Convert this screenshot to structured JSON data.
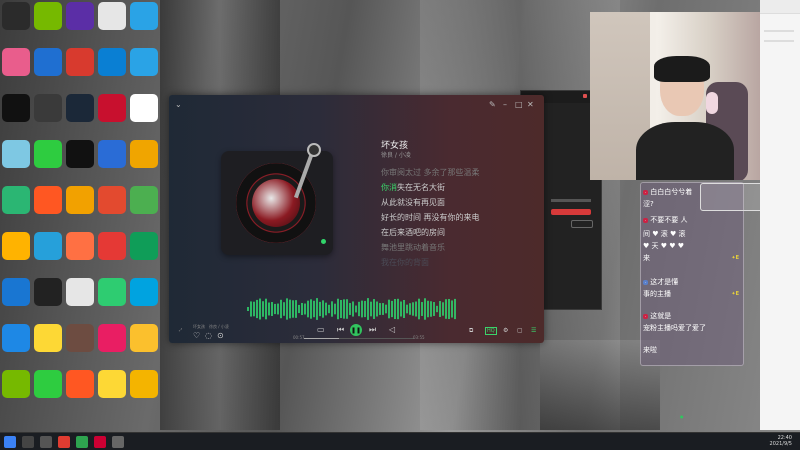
{
  "player": {
    "song_title": "坏女孩",
    "song_artist": "徐良 / 小凌",
    "lyrics": [
      "你审阅太过 多余了那些温柔",
      "你消失在无名大街",
      "从此就没有再见面",
      "好长的时间 再没有你的来电",
      "在后来酒吧的房间",
      "舞池里跳动着音乐",
      "我在你的背面"
    ],
    "highlight_prefix": "你消",
    "highlight_rest": "失在无名大街",
    "current_time": "00:57",
    "total_time": "03:55",
    "progress": 0.32,
    "now_playing_short": "坏女孩",
    "now_playing_sub": "徐良 / 小凌",
    "quality_label": "HQ"
  },
  "chat": {
    "messages": [
      {
        "badge": "",
        "text": "白白白兮兮",
        "tail": "着",
        "extra": ""
      },
      {
        "badge": "",
        "text": "涩?",
        "tail": "",
        "extra": ""
      },
      {
        "badge": "",
        "text": "不要不要  人",
        "tail": "",
        "extra": ""
      },
      {
        "badge": "",
        "text": "间 ♥ 滚 ♥ 滚",
        "tail": "",
        "extra": ""
      },
      {
        "badge": "",
        "text": "♥ 天 ♥ ♥ ♥",
        "tail": "",
        "extra": ""
      },
      {
        "badge": "",
        "text": "来",
        "tail": "",
        "extra": ""
      },
      {
        "badge": "",
        "text": "这才是懂",
        "tail": "",
        "extra": ""
      },
      {
        "badge": "",
        "text": "事的主播",
        "tail": "",
        "extra": ""
      },
      {
        "badge": "",
        "text": "这就是",
        "tail": "",
        "extra": ""
      },
      {
        "badge": "",
        "text": "宠粉主播吗爱了爱了",
        "tail": "",
        "extra": ""
      },
      {
        "badge": "",
        "text": "来啦",
        "tail": "",
        "extra": ""
      }
    ]
  },
  "taskbar": {
    "time": "22:40",
    "date": "2021/9/5"
  },
  "icons": {
    "player_logo": "music-app-icon",
    "play": "play-icon",
    "prev": "prev-icon",
    "next": "next-icon",
    "volume": "volume-icon",
    "like": "heart-icon"
  },
  "colors": {
    "accent": "#31c45e",
    "heart": "#ff2a4a"
  }
}
